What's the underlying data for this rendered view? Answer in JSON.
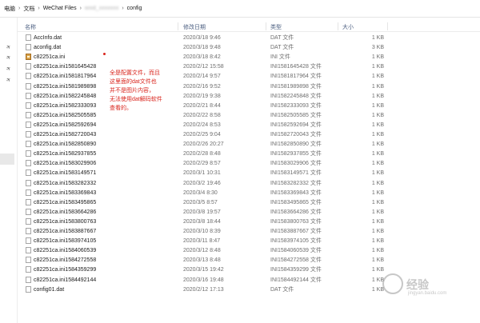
{
  "breadcrumb": [
    "电脑",
    "文档",
    "WeChat Files",
    "wxid_xxxxxxx",
    "config"
  ],
  "columns": {
    "name": "名称",
    "date": "修改日期",
    "type": "类型",
    "size": "大小"
  },
  "files": [
    {
      "name": "AccInfo.dat",
      "date": "2020/3/18 9:46",
      "type": "DAT 文件",
      "size": "1 KB",
      "icon": "dat"
    },
    {
      "name": "aconfig.dat",
      "date": "2020/3/18 9:48",
      "type": "DAT 文件",
      "size": "3 KB",
      "icon": "dat"
    },
    {
      "name": "c82251ca.ini",
      "date": "2020/3/18 8:42",
      "type": "INI 文件",
      "size": "1 KB",
      "icon": "ini"
    },
    {
      "name": "c82251ca.ini1581645428",
      "date": "2020/2/12 15:58",
      "type": "INI1581645428 文件",
      "size": "1 KB",
      "icon": "dat"
    },
    {
      "name": "c82251ca.ini1581817964",
      "date": "2020/2/14 9:57",
      "type": "INI1581817964 文件",
      "size": "1 KB",
      "icon": "dat"
    },
    {
      "name": "c82251ca.ini1581989898",
      "date": "2020/2/16 9:52",
      "type": "INI1581989898 文件",
      "size": "1 KB",
      "icon": "dat"
    },
    {
      "name": "c82251ca.ini1582245848",
      "date": "2020/2/19 9:38",
      "type": "INI1582245848 文件",
      "size": "1 KB",
      "icon": "dat"
    },
    {
      "name": "c82251ca.ini1582333093",
      "date": "2020/2/21 8:44",
      "type": "INI1582333093 文件",
      "size": "1 KB",
      "icon": "dat"
    },
    {
      "name": "c82251ca.ini1582505585",
      "date": "2020/2/22 8:58",
      "type": "INI1582505585 文件",
      "size": "1 KB",
      "icon": "dat"
    },
    {
      "name": "c82251ca.ini1582592694",
      "date": "2020/2/24 8:53",
      "type": "INI1582592694 文件",
      "size": "1 KB",
      "icon": "dat"
    },
    {
      "name": "c82251ca.ini1582720043",
      "date": "2020/2/25 9:04",
      "type": "INI1582720043 文件",
      "size": "1 KB",
      "icon": "dat"
    },
    {
      "name": "c82251ca.ini1582850890",
      "date": "2020/2/26 20:27",
      "type": "INI1582850890 文件",
      "size": "1 KB",
      "icon": "dat"
    },
    {
      "name": "c82251ca.ini1582937855",
      "date": "2020/2/28 8:48",
      "type": "INI1582937855 文件",
      "size": "1 KB",
      "icon": "dat"
    },
    {
      "name": "c82251ca.ini1583029906",
      "date": "2020/2/29 8:57",
      "type": "INI1583029906 文件",
      "size": "1 KB",
      "icon": "dat"
    },
    {
      "name": "c82251ca.ini1583149571",
      "date": "2020/3/1 10:31",
      "type": "INI1583149571 文件",
      "size": "1 KB",
      "icon": "dat"
    },
    {
      "name": "c82251ca.ini1583282332",
      "date": "2020/3/2 19:46",
      "type": "INI1583282332 文件",
      "size": "1 KB",
      "icon": "dat"
    },
    {
      "name": "c82251ca.ini1583369843",
      "date": "2020/3/4 8:30",
      "type": "INI1583369843 文件",
      "size": "1 KB",
      "icon": "dat"
    },
    {
      "name": "c82251ca.ini1583495865",
      "date": "2020/3/5 8:57",
      "type": "INI1583495865 文件",
      "size": "1 KB",
      "icon": "dat"
    },
    {
      "name": "c82251ca.ini1583664286",
      "date": "2020/3/8 19:57",
      "type": "INI1583664286 文件",
      "size": "1 KB",
      "icon": "dat"
    },
    {
      "name": "c82251ca.ini1583800763",
      "date": "2020/3/8 18:44",
      "type": "INI1583800763 文件",
      "size": "1 KB",
      "icon": "dat"
    },
    {
      "name": "c82251ca.ini1583887667",
      "date": "2020/3/10 8:39",
      "type": "INI1583887667 文件",
      "size": "1 KB",
      "icon": "dat"
    },
    {
      "name": "c82251ca.ini1583974105",
      "date": "2020/3/11 8:47",
      "type": "INI1583974105 文件",
      "size": "1 KB",
      "icon": "dat"
    },
    {
      "name": "c82251ca.ini1584060539",
      "date": "2020/3/12 8:48",
      "type": "INI1584060539 文件",
      "size": "1 KB",
      "icon": "dat"
    },
    {
      "name": "c82251ca.ini1584272558",
      "date": "2020/3/13 8:48",
      "type": "INI1584272558 文件",
      "size": "1 KB",
      "icon": "dat"
    },
    {
      "name": "c82251ca.ini1584359299",
      "date": "2020/3/15 19:42",
      "type": "INI1584359299 文件",
      "size": "1 KB",
      "icon": "dat"
    },
    {
      "name": "c82251ca.ini1584492144",
      "date": "2020/3/16 19:48",
      "type": "INI1584492144 文件",
      "size": "1 KB",
      "icon": "dat"
    },
    {
      "name": "config01.dat",
      "date": "2020/2/12 17:13",
      "type": "DAT 文件",
      "size": "1 KB",
      "icon": "dat"
    }
  ],
  "annotation": [
    "全是配置文件，而且",
    "这里面的dat文件也",
    "并不是图片内容，",
    "无法使用dat解码软件",
    "查看的。"
  ],
  "watermark": {
    "text": "经验",
    "url": "jingyan.baidu.com"
  },
  "colors": {
    "annotation": "#d9241c",
    "header": "#4d6082"
  }
}
